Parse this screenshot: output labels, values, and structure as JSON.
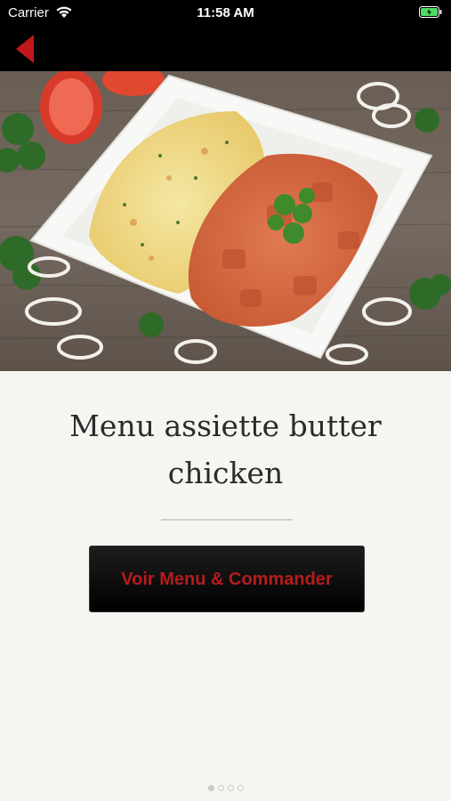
{
  "status_bar": {
    "carrier": "Carrier",
    "time": "11:58 AM"
  },
  "nav": {
    "back_icon": "back-arrow-icon",
    "accent_color": "#c0181b"
  },
  "hero": {
    "image": "butter-chicken-rice-plate"
  },
  "product": {
    "title": "Menu assiette butter chicken"
  },
  "cta": {
    "label": "Voir Menu & Commander",
    "text_color": "#b51c1c"
  },
  "pager": {
    "pages": 4,
    "current": 1
  }
}
